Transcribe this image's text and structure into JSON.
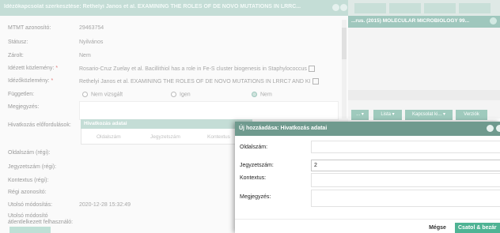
{
  "main_window": {
    "title": "Idézőkapcsolat szerkesztése: Rethelyi Janos et al. EXAMINING THE ROLES OF DE NOVO MUTATIONS IN LRRC..."
  },
  "form": {
    "mtmt_label": "MTMT azonosító:",
    "mtmt_value": "29463754",
    "status_label": "Státusz:",
    "status_value": "Nyilvános",
    "locked_label": "Zárolt:",
    "locked_value": "Nem",
    "cited_label": "Idézett közlemény:",
    "cited_value": "Rosario-Cruz Zuelay et al. Bacillithiol has a role in Fe-S cluster biogenesis in Staphylococcus",
    "citing_label": "Idézőközlemény:",
    "citing_value": "Rethelyi Janos et al. EXAMINING THE ROLES OF DE NOVO MUTATIONS IN LRRC7 AND KI",
    "independent_label": "Független:",
    "independent_options": [
      "Nem vizsgált",
      "Igen",
      "Nem"
    ],
    "notes_label": "Megjegyzés:",
    "ref_occurrence_label": "Hivatkozás előfordulások:",
    "page_old_label": "Oldalszám (régi):",
    "note_old_label": "Jegyzetszám (régi):",
    "context_old_label": "Kontextus (régi):",
    "old_id_label": "Régi azonosító:",
    "last_modified_label": "Utolsó módosítás:",
    "last_modified_value": "2020-12-28 15:32:49",
    "last_modifier_label": "Utolsó módosító",
    "last_modifier_label_2": "átlentlelkezett felhasználó:"
  },
  "ref_table": {
    "title": "Hivatkozás adatai",
    "columns": [
      "Oldalszám",
      "Jegyzetszám",
      "Kontextus"
    ]
  },
  "background_window": {
    "title": "...rus. (2015) MOLECULAR MICROBIOLOGY 99...",
    "buttons": [
      "... ▾",
      "Lista ▾",
      "Kapcsolat ki... ▾",
      "Verziók"
    ]
  },
  "modal": {
    "title": "Új hozzáadása: Hivatkozás adatai",
    "page_label": "Oldalszám:",
    "page_value": "",
    "note_label": "Jegyzetszám:",
    "note_value": "2",
    "context_label": "Kontextus:",
    "context_value": "",
    "comment_label": "Megjegyzés:",
    "comment_value": "",
    "cancel_label": "Mégse",
    "save_label": "Csatol & bezár"
  },
  "colors": {
    "header_teal": "#c4ddd6",
    "modal_header": "#6f9a8e",
    "save_green": "#4fb394",
    "required": "#e07a7a"
  }
}
